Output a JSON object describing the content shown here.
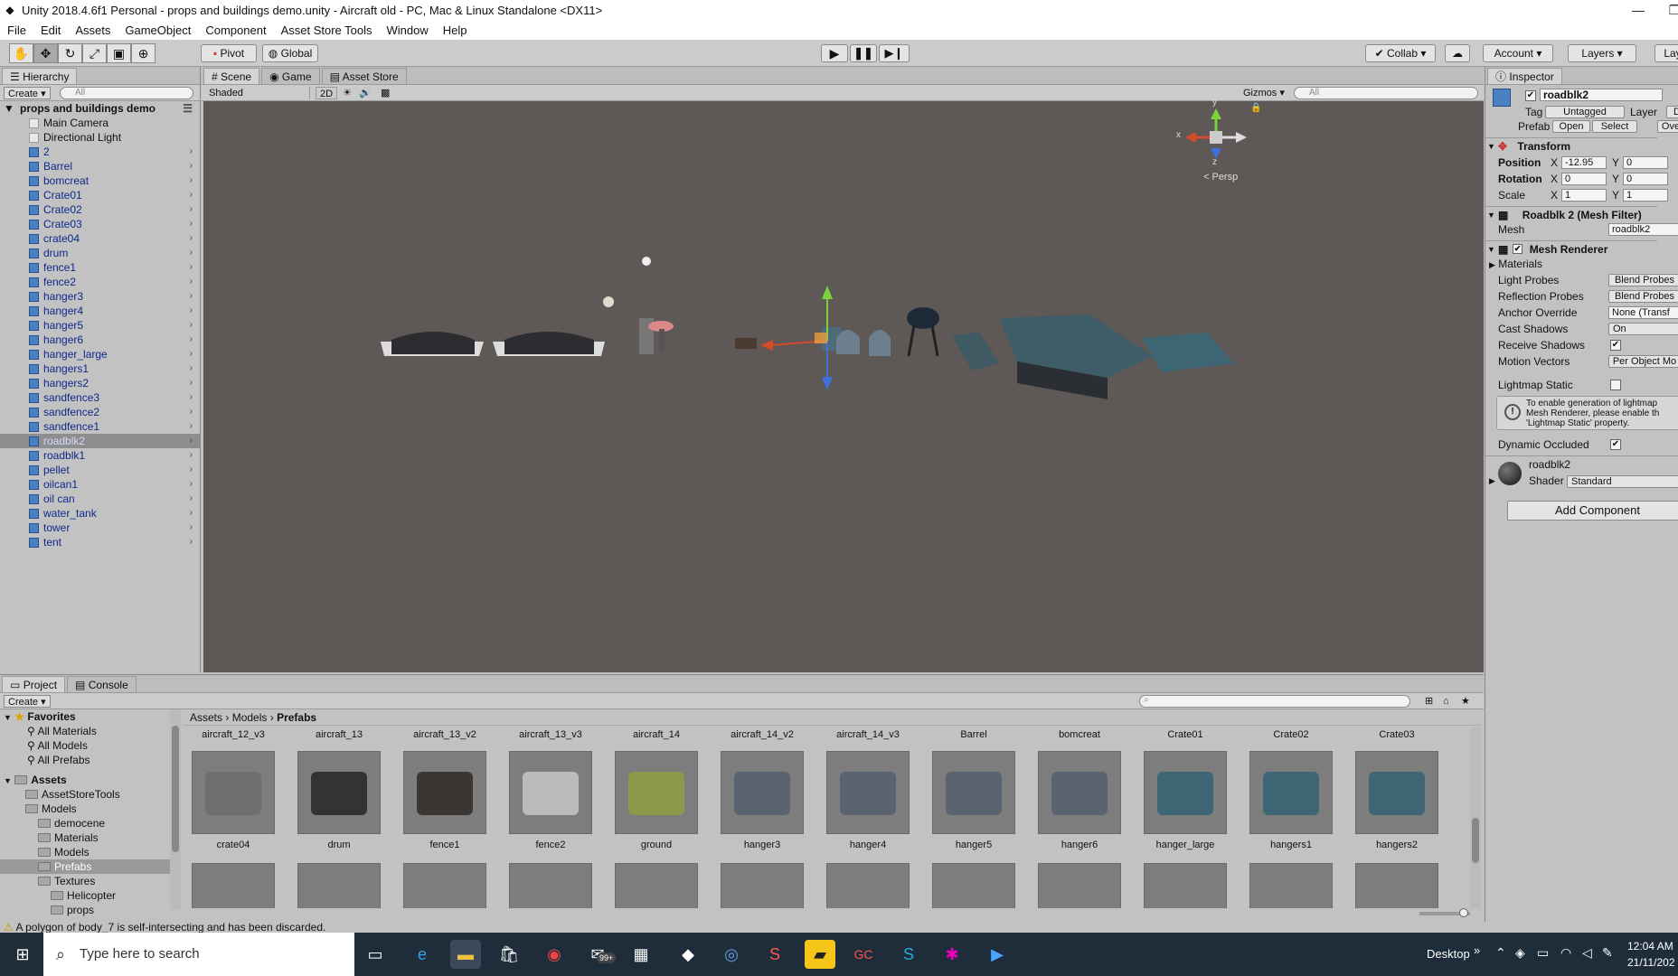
{
  "window": {
    "title": "Unity 2018.4.6f1 Personal - props and buildings demo.unity - Aircraft old - PC, Mac & Linux Standalone <DX11>",
    "minimize": "—",
    "restore": "❐"
  },
  "menu": [
    "File",
    "Edit",
    "Assets",
    "GameObject",
    "Component",
    "Asset Store Tools",
    "Window",
    "Help"
  ],
  "toolbar": {
    "pivot": "Pivot",
    "global": "Global",
    "collab": "Collab ▾",
    "account": "Account ▾",
    "layers": "Layers ▾",
    "layout": "Lay"
  },
  "hierarchy": {
    "tab": "Hierarchy",
    "create": "Create ▾",
    "search_placeholder": "All",
    "scene_name": "props and buildings demo",
    "items": [
      {
        "label": "Main Camera",
        "plain": true
      },
      {
        "label": "Directional Light",
        "plain": true
      },
      {
        "label": "2"
      },
      {
        "label": "Barrel"
      },
      {
        "label": "bomcreat"
      },
      {
        "label": "Crate01"
      },
      {
        "label": "Crate02"
      },
      {
        "label": "Crate03"
      },
      {
        "label": "crate04"
      },
      {
        "label": "drum"
      },
      {
        "label": "fence1"
      },
      {
        "label": "fence2"
      },
      {
        "label": "hanger3"
      },
      {
        "label": "hanger4"
      },
      {
        "label": "hanger5"
      },
      {
        "label": "hanger6"
      },
      {
        "label": "hanger_large"
      },
      {
        "label": "hangers1"
      },
      {
        "label": "hangers2"
      },
      {
        "label": "sandfence3"
      },
      {
        "label": "sandfence2"
      },
      {
        "label": "sandfence1"
      },
      {
        "label": "roadblk2",
        "selected": true
      },
      {
        "label": "roadblk1"
      },
      {
        "label": "pellet"
      },
      {
        "label": "oilcan1"
      },
      {
        "label": "oil can"
      },
      {
        "label": "water_tank"
      },
      {
        "label": "tower"
      },
      {
        "label": "tent"
      }
    ]
  },
  "scene": {
    "tabs": [
      "Scene",
      "Game",
      "Asset Store"
    ],
    "shading": "Shaded",
    "mode2d": "2D",
    "gizmos": "Gizmos ▾",
    "search_placeholder": "All",
    "persp": "< Persp",
    "axis_y": "y",
    "axis_x": "x",
    "axis_z": "z"
  },
  "inspector": {
    "tab": "Inspector",
    "object_name": "roadblk2",
    "tag_label": "Tag",
    "tag_value": "Untagged",
    "layer_label": "Layer",
    "layer_value": "De",
    "prefab_label": "Prefab",
    "prefab_open": "Open",
    "prefab_select": "Select",
    "prefab_overrides": "Ove",
    "transform_title": "Transform",
    "position_label": "Position",
    "position_x": "-12.95",
    "position_y": "0",
    "rotation_label": "Rotation",
    "rotation_x": "0",
    "rotation_y": "0",
    "scale_label": "Scale",
    "scale_x": "1",
    "scale_y": "1",
    "x_label": "X",
    "y_label": "Y",
    "mesh_filter_title": "Roadblk 2 (Mesh Filter)",
    "mesh_label": "Mesh",
    "mesh_value": "roadblk2",
    "mesh_renderer_title": "Mesh Renderer",
    "materials_label": "Materials",
    "light_probes_label": "Light Probes",
    "light_probes_value": "Blend Probes",
    "reflection_probes_label": "Reflection Probes",
    "reflection_probes_value": "Blend Probes",
    "anchor_override_label": "Anchor Override",
    "anchor_override_value": "None (Transf",
    "cast_shadows_label": "Cast Shadows",
    "cast_shadows_value": "On",
    "receive_shadows_label": "Receive Shadows",
    "motion_vectors_label": "Motion Vectors",
    "motion_vectors_value": "Per Object Mo",
    "lightmap_static_label": "Lightmap Static",
    "lightmap_info": "To enable generation of lightmap Mesh Renderer, please enable th 'Lightmap Static' property.",
    "dynamic_occluded_label": "Dynamic Occluded",
    "material_name": "roadblk2",
    "shader_label": "Shader",
    "shader_value": "Standard",
    "add_component": "Add Component"
  },
  "project": {
    "tabs": [
      "Project",
      "Console"
    ],
    "create": "Create ▾",
    "breadcrumb": [
      "Assets",
      "Models",
      "Prefabs"
    ],
    "favorites_label": "Favorites",
    "favorites": [
      "All Materials",
      "All Models",
      "All Prefabs"
    ],
    "assets_label": "Assets",
    "tree": [
      {
        "label": "AssetStoreTools",
        "indent": 1
      },
      {
        "label": "Models",
        "indent": 1
      },
      {
        "label": "democene",
        "indent": 2
      },
      {
        "label": "Materials",
        "indent": 2
      },
      {
        "label": "Models",
        "indent": 2
      },
      {
        "label": "Prefabs",
        "indent": 2,
        "selected": true
      },
      {
        "label": "Textures",
        "indent": 2
      },
      {
        "label": "Helicopter",
        "indent": 3
      },
      {
        "label": "props",
        "indent": 3
      }
    ],
    "top_labels": [
      "aircraft_12_v3",
      "aircraft_13",
      "aircraft_13_v2",
      "aircraft_13_v3",
      "aircraft_14",
      "aircraft_14_v2",
      "aircraft_14_v3",
      "Barrel",
      "bomcreat",
      "Crate01",
      "Crate02",
      "Crate03"
    ],
    "assets": [
      "crate04",
      "drum",
      "fence1",
      "fence2",
      "ground",
      "hanger3",
      "hanger4",
      "hanger5",
      "hanger6",
      "hanger_large",
      "hangers1",
      "hangers2"
    ]
  },
  "status": {
    "message": "A polygon of body_7 is self-intersecting and has been discarded."
  },
  "taskbar": {
    "search_placeholder": "Type here to search",
    "mail_badge": "99+",
    "desktop": "Desktop",
    "desktop_chevron": "»",
    "time": "12:04 AM",
    "date": "21/11/202"
  }
}
